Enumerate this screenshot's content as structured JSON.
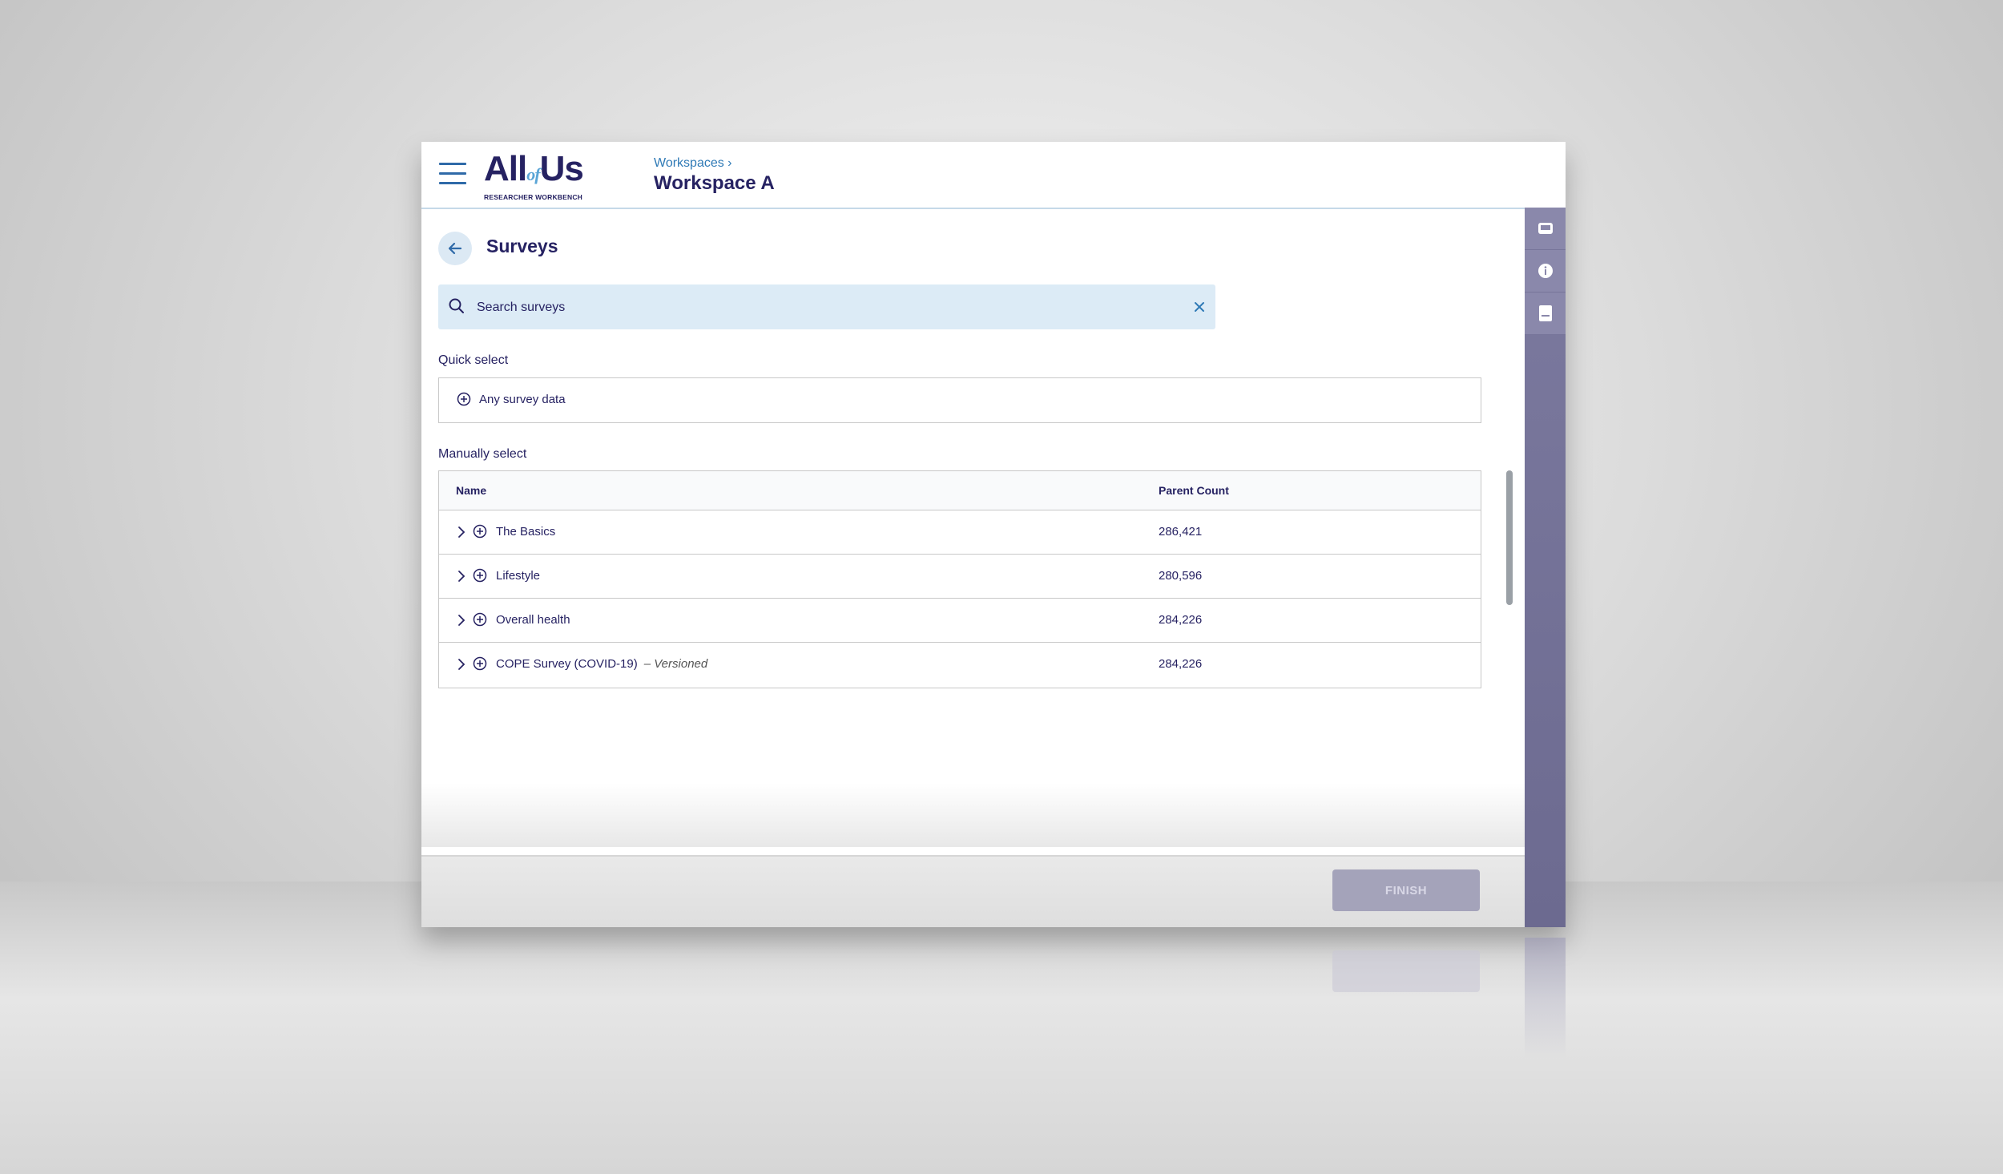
{
  "header": {
    "logo": {
      "main_left": "All",
      "main_of": "of",
      "main_right": "Us",
      "sub": "RESEARCHER WORKBENCH"
    },
    "breadcrumb": "Workspaces ›",
    "workspace_title": "Workspace A"
  },
  "page": {
    "title": "Surveys"
  },
  "search": {
    "placeholder": "Search surveys",
    "value": ""
  },
  "quick_select": {
    "label": "Quick select",
    "item": "Any survey data"
  },
  "manual_select": {
    "label": "Manually select",
    "columns": [
      "Name",
      "Parent Count"
    ],
    "rows": [
      {
        "name": "The Basics",
        "tag": "",
        "count": "286,421"
      },
      {
        "name": "Lifestyle",
        "tag": "",
        "count": "280,596"
      },
      {
        "name": "Overall health",
        "tag": "",
        "count": "284,226"
      },
      {
        "name": "COPE Survey (COVID-19)",
        "tag": "– Versioned",
        "count": "284,226"
      }
    ]
  },
  "footer": {
    "finish_label": "FINISH"
  },
  "sidebar": {
    "icons": [
      "inbox-icon",
      "info-icon",
      "book-icon"
    ]
  },
  "colors": {
    "navy": "#262262",
    "accent_blue": "#2f7ab6",
    "sidebar": "#7c7a9f",
    "search_bg": "#dcebf6",
    "finish_disabled": "#a4a3ba"
  }
}
